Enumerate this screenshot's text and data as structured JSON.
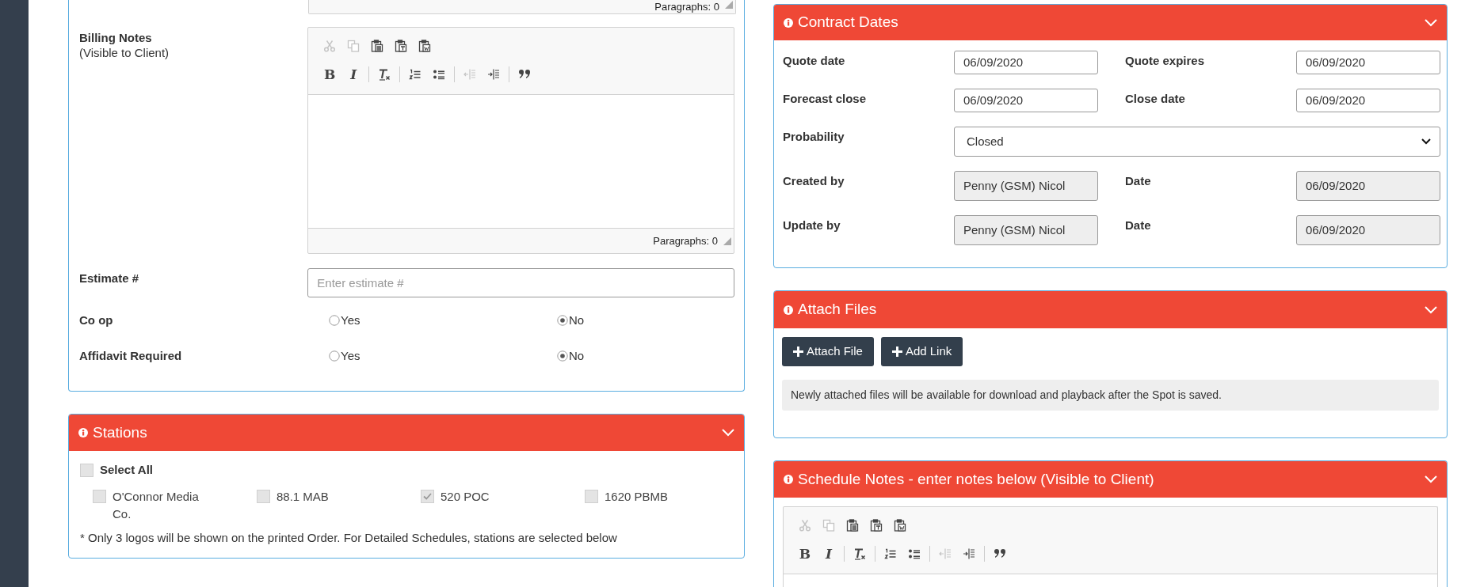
{
  "top_editor": {
    "status": "Paragraphs: 0"
  },
  "billing_form": {
    "billing_notes": {
      "label": "Billing Notes",
      "sublabel": "(Visible to Client)",
      "editor": {
        "status": "Paragraphs: 0",
        "toolbar_rows": [
          {
            "groups": [
              {
                "buttons": [
                  {
                    "kind": "cut",
                    "disabled": true
                  },
                  {
                    "kind": "copy",
                    "disabled": true
                  },
                  {
                    "kind": "paste",
                    "disabled": false
                  },
                  {
                    "kind": "paste-text",
                    "disabled": false
                  },
                  {
                    "kind": "paste-word",
                    "disabled": false
                  }
                ]
              }
            ]
          },
          {
            "groups": [
              {
                "buttons": [
                  {
                    "kind": "bold",
                    "label": "B",
                    "disabled": false
                  },
                  {
                    "kind": "italic",
                    "label": "I",
                    "disabled": false
                  }
                ]
              },
              {
                "buttons": [
                  {
                    "kind": "remove-format",
                    "disabled": false
                  }
                ]
              },
              {
                "buttons": [
                  {
                    "kind": "numbered-list",
                    "disabled": false
                  },
                  {
                    "kind": "bulleted-list",
                    "disabled": false
                  }
                ]
              },
              {
                "buttons": [
                  {
                    "kind": "outdent",
                    "disabled": true
                  },
                  {
                    "kind": "indent",
                    "disabled": false
                  }
                ]
              },
              {
                "buttons": [
                  {
                    "kind": "blockquote",
                    "disabled": false
                  }
                ]
              }
            ]
          }
        ]
      }
    },
    "estimate": {
      "label": "Estimate #",
      "placeholder": "Enter estimate #"
    },
    "radio_groups": [
      {
        "label": "Co op",
        "options": [
          {
            "label": "Yes",
            "selected": false
          },
          {
            "label": "No",
            "selected": true
          }
        ]
      },
      {
        "label": "Affidavit Required",
        "options": [
          {
            "label": "Yes",
            "selected": false
          },
          {
            "label": "No",
            "selected": true
          }
        ]
      }
    ]
  },
  "stations": {
    "title": "Stations",
    "select_all": {
      "label": "Select All",
      "checked": false
    },
    "items": [
      {
        "label": "O'Connor Media Co.",
        "checked": false
      },
      {
        "label": "88.1 MAB",
        "checked": false
      },
      {
        "label": "520 POC",
        "checked": true
      },
      {
        "label": "1620 PBMB",
        "checked": false
      }
    ],
    "note": "* Only 3 logos will be shown on the printed Order. For Detailed Schedules, stations are selected below"
  },
  "contract_dates": {
    "title": "Contract Dates",
    "rows": [
      {
        "fields": [
          {
            "label": "Quote date",
            "value": "06/09/2020",
            "kind": "date"
          },
          {
            "label": "Quote expires",
            "value": "06/09/2020",
            "kind": "date"
          }
        ]
      },
      {
        "fields": [
          {
            "label": "Forecast close",
            "value": "06/09/2020",
            "kind": "date"
          },
          {
            "label": "Close date",
            "value": "06/09/2020",
            "kind": "date"
          }
        ]
      },
      {
        "fields": [
          {
            "label": "Probability",
            "value": "Closed",
            "kind": "select"
          }
        ]
      },
      {
        "fields": [
          {
            "label": "Created by",
            "value": "Penny (GSM) Nicol",
            "kind": "readonly"
          },
          {
            "label": "Date",
            "value": "06/09/2020",
            "kind": "readonly"
          }
        ]
      },
      {
        "fields": [
          {
            "label": "Update by",
            "value": "Penny (GSM) Nicol",
            "kind": "readonly"
          },
          {
            "label": "Date",
            "value": "06/09/2020",
            "kind": "readonly"
          }
        ]
      }
    ]
  },
  "attach_files": {
    "title": "Attach Files",
    "buttons": [
      "Attach File",
      "Add Link"
    ],
    "info": "Newly attached files will be available for download and playback after the Spot is saved."
  },
  "schedule_notes": {
    "title": "Schedule Notes - enter notes below (Visible to Client)",
    "editor": {
      "toolbar_rows": [
        {
          "groups": [
            {
              "buttons": [
                {
                  "kind": "cut",
                  "disabled": true
                },
                {
                  "kind": "copy",
                  "disabled": true
                },
                {
                  "kind": "paste",
                  "disabled": false
                },
                {
                  "kind": "paste-text",
                  "disabled": false
                },
                {
                  "kind": "paste-word",
                  "disabled": false
                }
              ]
            }
          ]
        },
        {
          "groups": [
            {
              "buttons": [
                {
                  "kind": "bold",
                  "label": "B",
                  "disabled": false
                },
                {
                  "kind": "italic",
                  "label": "I",
                  "disabled": false
                }
              ]
            },
            {
              "buttons": [
                {
                  "kind": "remove-format",
                  "disabled": false
                }
              ]
            },
            {
              "buttons": [
                {
                  "kind": "numbered-list",
                  "disabled": false
                },
                {
                  "kind": "bulleted-list",
                  "disabled": false
                }
              ]
            },
            {
              "buttons": [
                {
                  "kind": "outdent",
                  "disabled": true
                },
                {
                  "kind": "indent",
                  "disabled": false
                }
              ]
            },
            {
              "buttons": [
                {
                  "kind": "blockquote",
                  "disabled": false
                }
              ]
            }
          ]
        }
      ]
    }
  }
}
